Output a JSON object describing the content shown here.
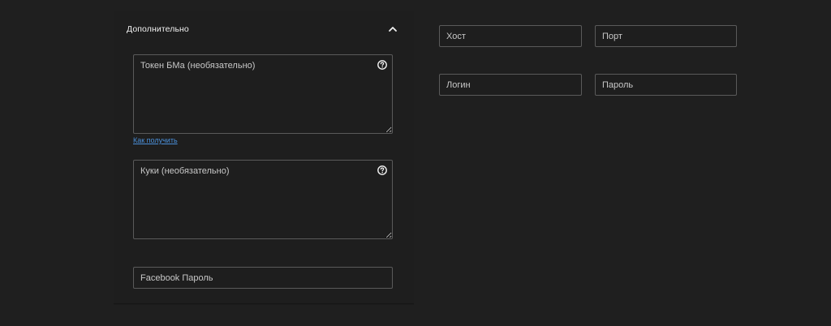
{
  "accordion": {
    "title": "Дополнительно",
    "toggle_icon": "chevron-up-icon"
  },
  "bm_token": {
    "placeholder": "Токен БМа (необязательно)",
    "value": "",
    "help_icon": "question-circle-icon"
  },
  "how_to_get_link": "Как получить",
  "cookies": {
    "placeholder": "Куки (необязательно)",
    "value": "",
    "help_icon": "question-circle-icon"
  },
  "facebook_password": {
    "placeholder": "Facebook Пароль",
    "value": ""
  },
  "proxy": {
    "host_placeholder": "Хост",
    "port_placeholder": "Порт",
    "login_placeholder": "Логин",
    "password_placeholder": "Пароль"
  }
}
